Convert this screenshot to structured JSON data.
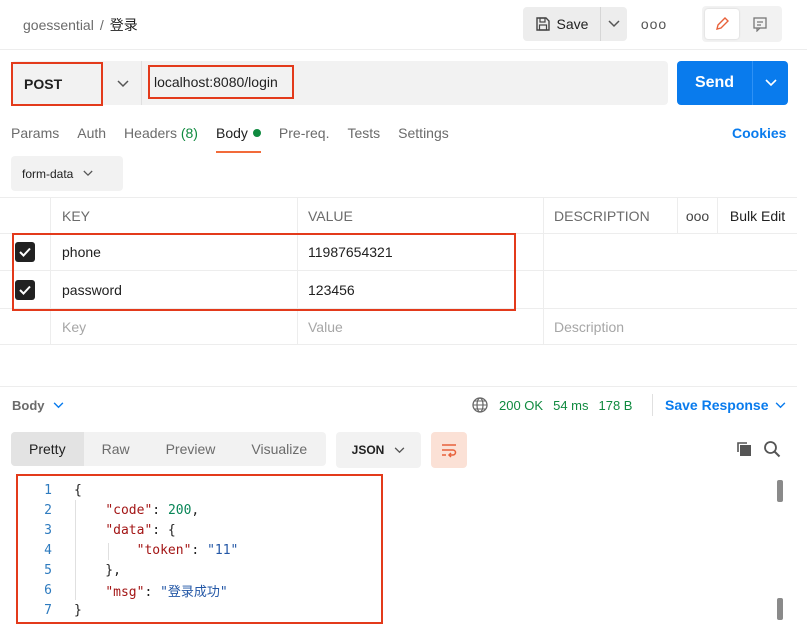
{
  "header": {
    "workspace": "goessential",
    "separator": "/",
    "request_name": "登录",
    "save_label": "Save",
    "more_label": "ooo"
  },
  "request": {
    "method": "POST",
    "url": "localhost:8080/login",
    "send_label": "Send"
  },
  "request_tabs": [
    {
      "label": "Params"
    },
    {
      "label": "Auth"
    },
    {
      "label": "Headers",
      "count": "(8)"
    },
    {
      "label": "Body"
    },
    {
      "label": "Pre-req."
    },
    {
      "label": "Tests"
    },
    {
      "label": "Settings"
    }
  ],
  "cookies_label": "Cookies",
  "body_type": "form-data",
  "params_table": {
    "headers": {
      "key": "KEY",
      "value": "VALUE",
      "description": "DESCRIPTION",
      "more": "ooo",
      "bulk_edit": "Bulk Edit"
    },
    "rows": [
      {
        "key": "phone",
        "value": "11987654321",
        "description": "",
        "checked": true
      },
      {
        "key": "password",
        "value": "123456",
        "description": "",
        "checked": true
      }
    ],
    "placeholders": {
      "key": "Key",
      "value": "Value",
      "description": "Description"
    }
  },
  "response": {
    "label": "Body",
    "status": "200 OK",
    "time": "54 ms",
    "size": "178 B",
    "save_response_label": "Save Response",
    "view_tabs": [
      "Pretty",
      "Raw",
      "Preview",
      "Visualize"
    ],
    "format": "JSON"
  },
  "code_lines": [
    {
      "n": "1",
      "text": "{"
    },
    {
      "n": "2",
      "text": "    \"code\": 200,"
    },
    {
      "n": "3",
      "text": "    \"data\": {"
    },
    {
      "n": "4",
      "text": "        \"token\": \"11\""
    },
    {
      "n": "5",
      "text": "    },"
    },
    {
      "n": "6",
      "text": "    \"msg\": \"登录成功\""
    },
    {
      "n": "7",
      "text": "}"
    }
  ],
  "colors": {
    "accent": "#097bed",
    "highlight": "#e33a1b",
    "success": "#0f8a3f",
    "active_tab": "#f26b3a"
  }
}
